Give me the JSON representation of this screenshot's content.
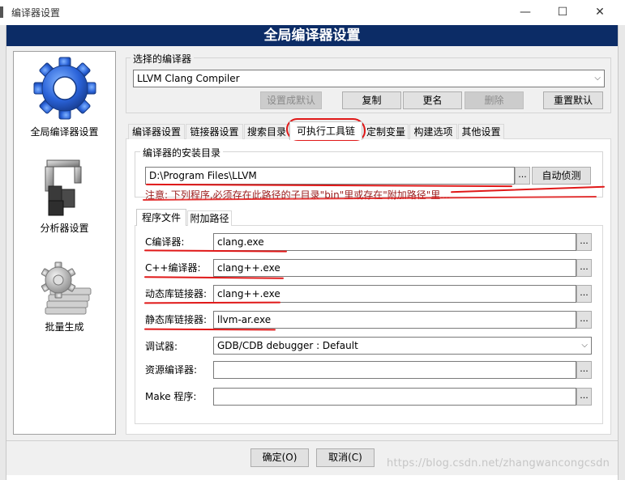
{
  "window": {
    "title": "编译器设置",
    "controls": {
      "minimize": "—",
      "maximize": "☐",
      "close": "✕"
    }
  },
  "header": {
    "title": "全局编译器设置"
  },
  "left_nav": [
    {
      "label": "全局编译器设置",
      "icon": "gear-icon"
    },
    {
      "label": "分析器设置",
      "icon": "debugger-tools-icon"
    },
    {
      "label": "批量生成",
      "icon": "batch-build-gear-icon"
    }
  ],
  "compiler_select": {
    "group_title": "选择的编译器",
    "selected": "LLVM Clang Compiler",
    "buttons": {
      "set_default": "设置成默认",
      "copy": "复制",
      "rename": "更名",
      "delete": "删除",
      "reset_defaults": "重置默认"
    }
  },
  "tabs": [
    "编译器设置",
    "链接器设置",
    "搜索目录",
    "可执行工具链",
    "定制变量",
    "构建选项",
    "其他设置"
  ],
  "install_dir": {
    "group_title": "编译器的安装目录",
    "value": "D:\\Program Files\\LLVM",
    "browse": "...",
    "auto_detect": "自动侦测",
    "note": "注意: 下列程序,必须存在此路径的子目录\"bin\"里或存在\"附加路径\"里..."
  },
  "subtabs": [
    "程序文件",
    "附加路径"
  ],
  "programs": [
    {
      "label": "C编译器:",
      "value": "clang.exe",
      "type": "field"
    },
    {
      "label": "C++编译器:",
      "value": "clang++.exe",
      "type": "field"
    },
    {
      "label": "动态库链接器:",
      "value": "clang++.exe",
      "type": "field"
    },
    {
      "label": "静态库链接器:",
      "value": "llvm-ar.exe",
      "type": "field"
    },
    {
      "label": "调试器:",
      "value": "GDB/CDB debugger : Default",
      "type": "combo"
    },
    {
      "label": "资源编译器:",
      "value": "",
      "type": "field"
    },
    {
      "label": "Make 程序:",
      "value": "",
      "type": "field"
    }
  ],
  "browse_label": "...",
  "footer": {
    "ok": "确定(O)",
    "cancel": "取消(C)"
  },
  "watermark": "https://blog.csdn.net/zhangwancongcsdn",
  "colors": {
    "header_band": "#0c2c66",
    "annotation_red": "#e01818",
    "note_text": "#9a1c1c"
  }
}
